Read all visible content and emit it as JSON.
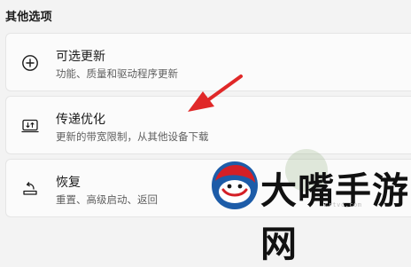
{
  "section": {
    "title": "其他选项"
  },
  "items": [
    {
      "icon": "plus-circle-icon",
      "title": "可选更新",
      "desc": "功能、质量和驱动程序更新"
    },
    {
      "icon": "delivery-optimization-icon",
      "title": "传递优化",
      "desc": "更新的带宽限制，从其他设备下载"
    },
    {
      "icon": "recovery-icon",
      "title": "恢复",
      "desc": "重置、高级启动、返回"
    }
  ],
  "annotation": {
    "color": "#e02828"
  },
  "watermark": {
    "brand": "大嘴手游网",
    "url": "crtvc.com"
  }
}
